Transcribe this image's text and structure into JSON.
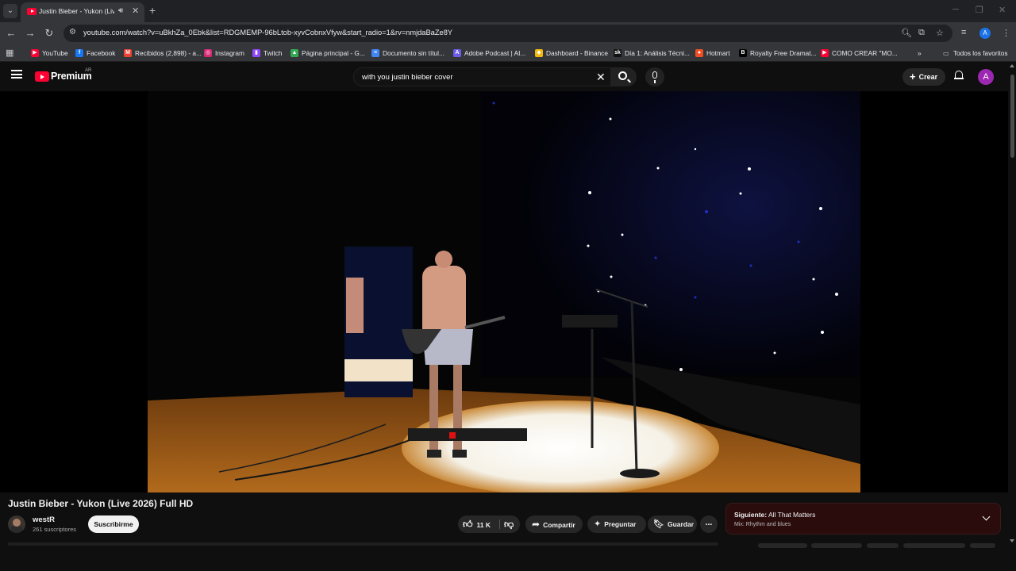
{
  "browser": {
    "tab_title": "Justin Bieber - Yukon (Live",
    "url": "youtube.com/watch?v=uBkhZa_0Ebk&list=RDGMEMP-96bLtob-xyvCobnxVfyw&start_radio=1&rv=nmjdaBaZe8Y",
    "profile_initial": "A",
    "bookmarks": [
      {
        "label": "YouTube",
        "icon": "youtube-icon",
        "color": "#ff0033"
      },
      {
        "label": "Facebook",
        "icon": "facebook-icon",
        "color": "#1877f2"
      },
      {
        "label": "Recibidos (2,898) - a...",
        "icon": "gmail-icon",
        "color": "#ea4335"
      },
      {
        "label": "Instagram",
        "icon": "instagram-icon",
        "color": "#d62976"
      },
      {
        "label": "Twitch",
        "icon": "twitch-icon",
        "color": "#9146ff"
      },
      {
        "label": "Página principal - G...",
        "icon": "drive-icon",
        "color": "#34a853"
      },
      {
        "label": "Documento sin títul...",
        "icon": "docs-icon",
        "color": "#4285f4"
      },
      {
        "label": "Adobe Podcast | AI...",
        "icon": "adobe-podcast-icon",
        "color": "#6d5ce8"
      },
      {
        "label": "Dashboard - Binance",
        "icon": "binance-icon",
        "color": "#f0b90b"
      },
      {
        "label": "Día 1: Análisis Técni...",
        "icon": "sk-icon",
        "color": "#111111"
      },
      {
        "label": "Hotmart",
        "icon": "hotmart-icon",
        "color": "#f04e23"
      },
      {
        "label": "Royalty Free Dramat...",
        "icon": "b-icon",
        "color": "#000000"
      },
      {
        "label": "COMO CREAR \"MO...",
        "icon": "youtube-icon",
        "color": "#ff0033"
      }
    ],
    "all_bookmarks": "Todos los favoritos"
  },
  "youtube": {
    "brand": "Premium",
    "country": "AR",
    "search_query": "with you justin bieber cover",
    "create_label": "Crear",
    "avatar_initial": "A"
  },
  "video": {
    "title": "Justin Bieber - Yukon (Live 2026) Full HD",
    "channel": "westR",
    "subscribers": "261 suscriptores",
    "subscribe_label": "Suscribirme",
    "likes": "11 K",
    "share_label": "Compartir",
    "ask_label": "Preguntar",
    "save_label": "Guardar"
  },
  "up_next": {
    "label": "Siguiente:",
    "title": "All That Matters",
    "subtitle": "Mix: Rhythm and blues"
  },
  "colors": {
    "accent_red": "#ff0033",
    "avatar_purple": "#9c27b0",
    "up_next_bg": "#2b0c0c"
  }
}
